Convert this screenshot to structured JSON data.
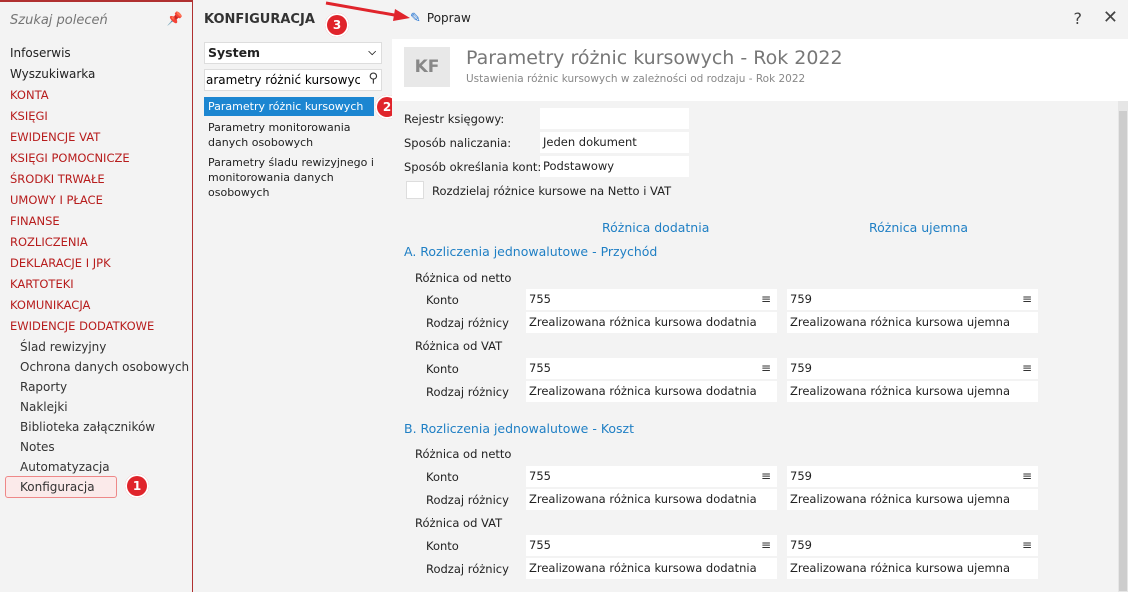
{
  "sidebar": {
    "search_placeholder": "Szukaj poleceń",
    "items": [
      {
        "label": "Infoserwis",
        "style": "normal"
      },
      {
        "label": "Wyszukiwarka",
        "style": "normal"
      },
      {
        "label": "KONTA",
        "style": "red"
      },
      {
        "label": "KSIĘGI",
        "style": "red"
      },
      {
        "label": "EWIDENCJE VAT",
        "style": "red"
      },
      {
        "label": "KSIĘGI POMOCNICZE",
        "style": "red"
      },
      {
        "label": "ŚRODKI TRWAŁE",
        "style": "red"
      },
      {
        "label": "UMOWY I PŁACE",
        "style": "red"
      },
      {
        "label": "FINANSE",
        "style": "red"
      },
      {
        "label": "ROZLICZENIA",
        "style": "red"
      },
      {
        "label": "DEKLARACJE I JPK",
        "style": "red"
      },
      {
        "label": "KARTOTEKI",
        "style": "red"
      },
      {
        "label": "KOMUNIKACJA",
        "style": "red"
      },
      {
        "label": "EWIDENCJE DODATKOWE",
        "style": "red"
      }
    ],
    "subitems": [
      "Ślad rewizyjny",
      "Ochrona danych osobowych",
      "Raporty",
      "Naklejki",
      "Biblioteka załączników",
      "Notes",
      "Automatyzacja",
      "Konfiguracja"
    ]
  },
  "config": {
    "title": "KONFIGURACJA",
    "select_value": "System",
    "filter_value": "arametry różnić kursowych",
    "results": [
      "Parametry różnic kursowych",
      "Parametry monitorowania danych osobowych",
      "Parametry śladu rewizyjnego i monitorowania danych osobowych"
    ]
  },
  "badges": {
    "b1": "1",
    "b2": "2",
    "b3": "3"
  },
  "toolbar": {
    "edit_label": "Popraw",
    "help": "?",
    "close": "✕"
  },
  "header": {
    "logo": "KF",
    "title": "Parametry różnic kursowych - Rok 2022",
    "subtitle": "Ustawienia różnic kursowych w zależności od rodzaju - Rok 2022"
  },
  "form": {
    "rejestr_label": "Rejestr księgowy:",
    "rejestr_value": "",
    "sposob_label": "Sposób naliczania:",
    "sposob_value": "Jeden dokument",
    "konta_label": "Sposób określania kont:",
    "konta_value": "Podstawowy",
    "checkbox_label": "Rozdzielaj różnice kursowe na Netto i VAT",
    "col_positive": "Różnica dodatnia",
    "col_negative": "Różnica ujemna",
    "sections": [
      {
        "title": "A. Rozliczenia jednowalutowe - Przychód",
        "groups": [
          {
            "label": "Różnica od netto",
            "konto_label": "Konto",
            "konto_pos": "755",
            "konto_neg": "759",
            "rodzaj_label": "Rodzaj różnicy",
            "rodzaj_pos": "Zrealizowana różnica kursowa dodatnia",
            "rodzaj_neg": "Zrealizowana różnica kursowa ujemna"
          },
          {
            "label": "Różnica od VAT",
            "konto_label": "Konto",
            "konto_pos": "755",
            "konto_neg": "759",
            "rodzaj_label": "Rodzaj różnicy",
            "rodzaj_pos": "Zrealizowana różnica kursowa dodatnia",
            "rodzaj_neg": "Zrealizowana różnica kursowa ujemna"
          }
        ]
      },
      {
        "title": "B. Rozliczenia jednowalutowe - Koszt",
        "groups": [
          {
            "label": "Różnica od netto",
            "konto_label": "Konto",
            "konto_pos": "755",
            "konto_neg": "759",
            "rodzaj_label": "Rodzaj różnicy",
            "rodzaj_pos": "Zrealizowana różnica kursowa dodatnia",
            "rodzaj_neg": "Zrealizowana różnica kursowa ujemna"
          },
          {
            "label": "Różnica od VAT",
            "konto_label": "Konto",
            "konto_pos": "755",
            "konto_neg": "759",
            "rodzaj_label": "Rodzaj różnicy",
            "rodzaj_pos": "Zrealizowana różnica kursowa dodatnia",
            "rodzaj_neg": "Zrealizowana różnica kursowa ujemna"
          }
        ]
      }
    ]
  },
  "colors": {
    "accent_red": "#b71c1c",
    "accent_blue": "#1f7fc4",
    "selection": "#1c86d1",
    "badge": "#e0242b"
  }
}
